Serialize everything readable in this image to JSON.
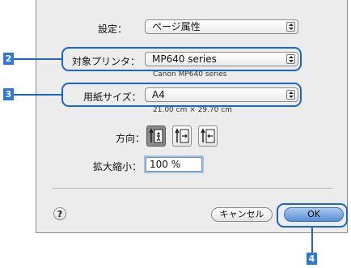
{
  "dialog": {
    "settings_label": "設定：",
    "settings_value": "ページ属性",
    "printer_label": "対象プリンタ：",
    "printer_value": "MP640 series",
    "printer_sub": "Canon MP640 series",
    "paper_label": "用紙サイズ：",
    "paper_value": "A4",
    "paper_sub": "21.00 cm × 29.70 cm",
    "orientation_label": "方向：",
    "scale_label": "拡大縮小：",
    "scale_value": "100 %",
    "help_label": "?",
    "cancel_label": "キャンセル",
    "ok_label": "OK"
  },
  "callouts": {
    "n2": "2",
    "n3": "3",
    "n4": "4"
  },
  "colors": {
    "callout": "#1a66cc",
    "number_badge": "#2f79d4"
  }
}
